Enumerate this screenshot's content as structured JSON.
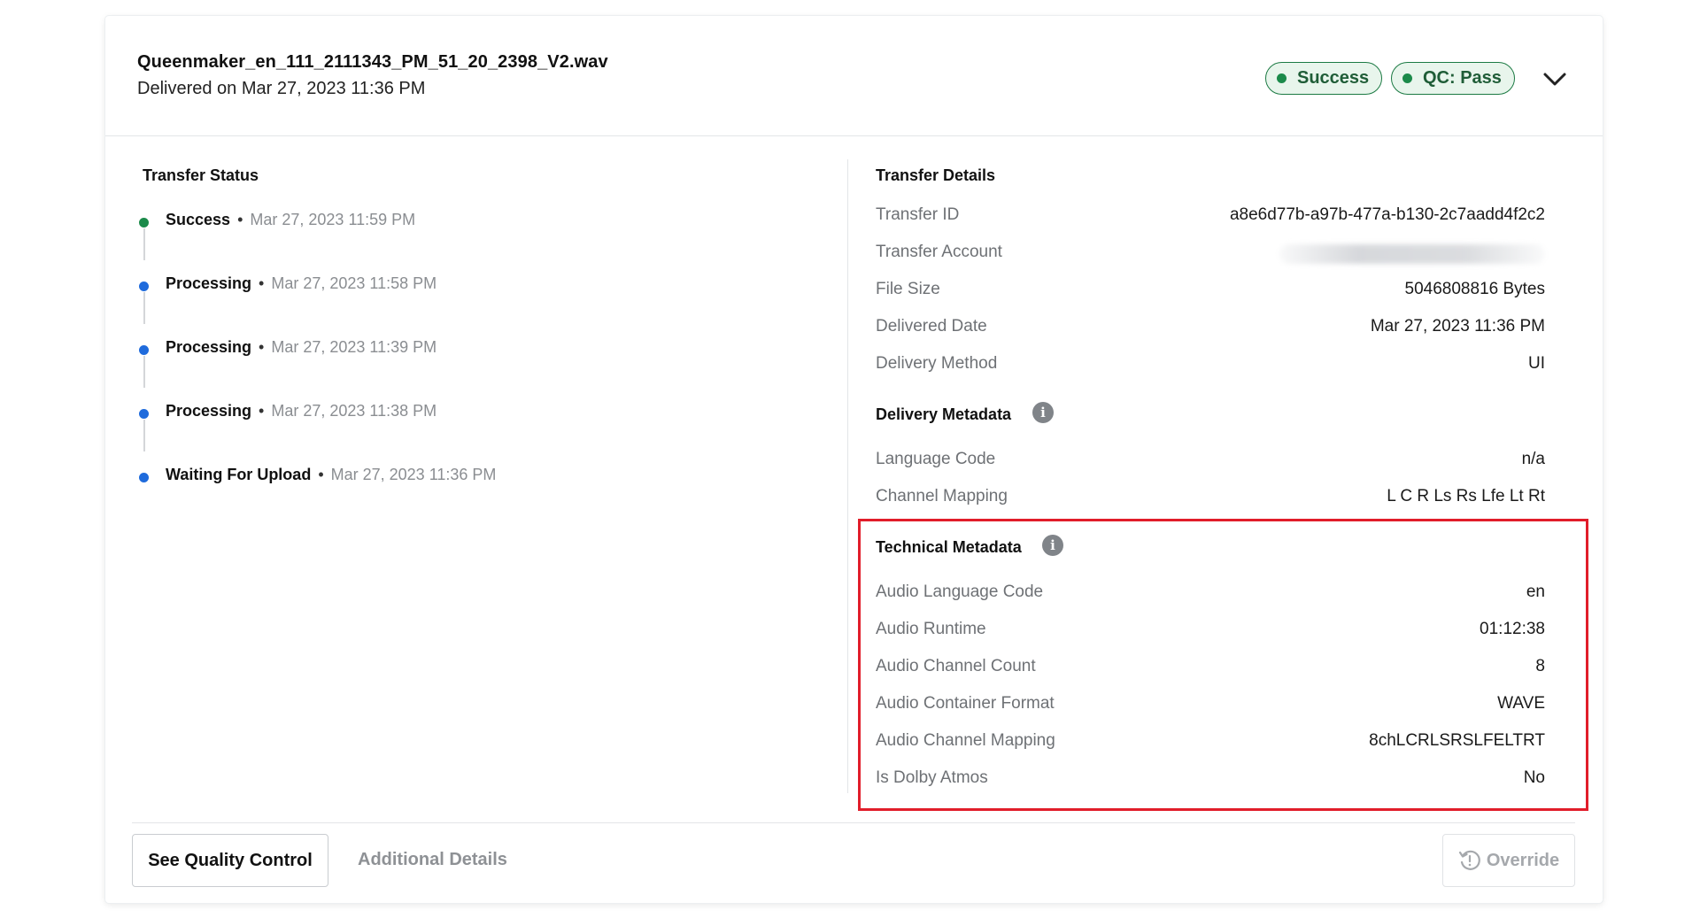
{
  "header": {
    "file_name": "Queenmaker_en_111_2111343_PM_51_20_2398_V2.wav",
    "delivered_on": "Delivered on Mar 27, 2023 11:36 PM",
    "badges": [
      {
        "label": "Success",
        "color": "#1b8a4a"
      },
      {
        "label": "QC: Pass",
        "color": "#1b8a4a"
      }
    ],
    "expand_icon": "chevron-down-icon"
  },
  "transfer_status": {
    "title": "Transfer Status",
    "items": [
      {
        "status": "Success",
        "time": "Mar 27, 2023 11:59 PM",
        "color": "#1b8a4a"
      },
      {
        "status": "Processing",
        "time": "Mar 27, 2023 11:58 PM",
        "color": "#1f6bdc"
      },
      {
        "status": "Processing",
        "time": "Mar 27, 2023 11:39 PM",
        "color": "#1f6bdc"
      },
      {
        "status": "Processing",
        "time": "Mar 27, 2023 11:38 PM",
        "color": "#1f6bdc"
      },
      {
        "status": "Waiting For Upload",
        "time": "Mar 27, 2023 11:36 PM",
        "color": "#1f6bdc"
      }
    ]
  },
  "transfer_details": {
    "title": "Transfer Details",
    "rows": [
      {
        "label": "Transfer ID",
        "value": "a8e6d77b-a97b-477a-b130-2c7aadd4f2c2"
      },
      {
        "label": "Transfer Account",
        "value": ""
      },
      {
        "label": "File Size",
        "value": "5046808816 Bytes"
      },
      {
        "label": "Delivered Date",
        "value": "Mar 27, 2023 11:36 PM"
      },
      {
        "label": "Delivery Method",
        "value": "UI"
      }
    ]
  },
  "delivery_metadata": {
    "title": "Delivery Metadata",
    "rows": [
      {
        "label": "Language Code",
        "value": "n/a"
      },
      {
        "label": "Channel Mapping",
        "value": "L C R Ls Rs Lfe Lt Rt"
      }
    ]
  },
  "technical_metadata": {
    "title": "Technical Metadata",
    "highlight_color": "#e11d2a",
    "rows": [
      {
        "label": "Audio Language Code",
        "value": "en"
      },
      {
        "label": "Audio Runtime",
        "value": "01:12:38"
      },
      {
        "label": "Audio Channel Count",
        "value": "8"
      },
      {
        "label": "Audio Container Format",
        "value": "WAVE"
      },
      {
        "label": "Audio Channel Mapping",
        "value": "8chLCRLSRSLFELTRT"
      },
      {
        "label": "Is Dolby Atmos",
        "value": "No"
      }
    ]
  },
  "info_icon_glyph": "i",
  "footer": {
    "see_qc_label": "See Quality Control",
    "additional_details_label": "Additional Details",
    "override_label": "Override"
  }
}
